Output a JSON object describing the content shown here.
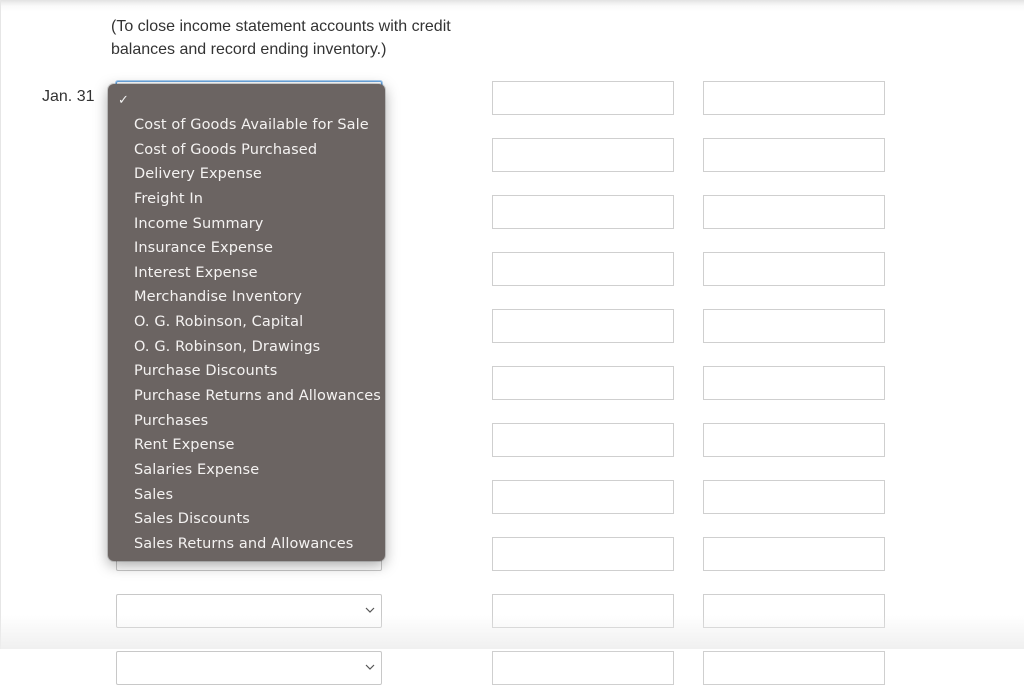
{
  "instruction_note": "(To close income statement accounts with credit balances and record ending inventory.)",
  "entry": {
    "date_label": "Jan. 31",
    "selected_account": ""
  },
  "dropdown": {
    "checkmark": "✓",
    "options": [
      "Cost of Goods Available for Sale",
      "Cost of Goods Purchased",
      "Delivery Expense",
      "Freight In",
      "Income Summary",
      "Insurance Expense",
      "Interest Expense",
      "Merchandise Inventory",
      "O. G. Robinson, Capital",
      "O. G. Robinson, Drawings",
      "Purchase Discounts",
      "Purchase Returns and Allowances",
      "Purchases",
      "Rent Expense",
      "Salaries Expense",
      "Sales",
      "Sales Discounts",
      "Sales Returns and Allowances"
    ]
  },
  "rows": [
    {
      "account": "",
      "debit": "",
      "credit": ""
    },
    {
      "account": "",
      "debit": "",
      "credit": ""
    },
    {
      "account": "",
      "debit": "",
      "credit": ""
    },
    {
      "account": "",
      "debit": "",
      "credit": ""
    },
    {
      "account": "",
      "debit": "",
      "credit": ""
    },
    {
      "account": "",
      "debit": "",
      "credit": ""
    },
    {
      "account": "",
      "debit": "",
      "credit": ""
    },
    {
      "account": "",
      "debit": "",
      "credit": ""
    },
    {
      "account": "",
      "debit": "",
      "credit": ""
    },
    {
      "account": "",
      "debit": "",
      "credit": ""
    },
    {
      "account": "",
      "debit": "",
      "credit": ""
    }
  ],
  "colors": {
    "dropdown_bg": "#6b6462",
    "focus_border": "#6aa6e0",
    "text": "#333333"
  }
}
